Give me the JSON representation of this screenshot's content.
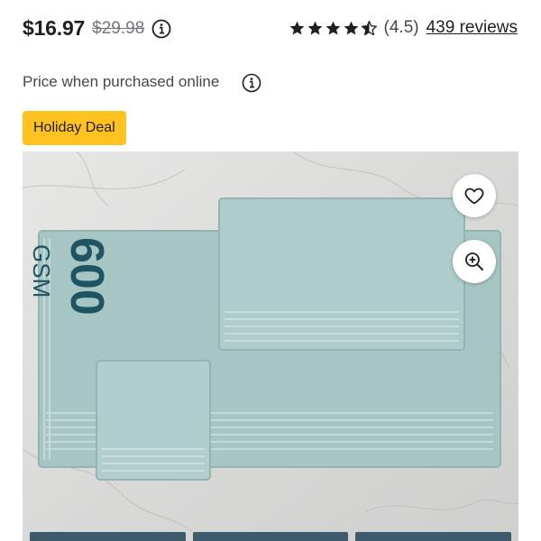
{
  "price": {
    "current": "$16.97",
    "was": "$29.98",
    "note": "Price when purchased online"
  },
  "rating": {
    "stars": 4.5,
    "value_text": "(4.5)",
    "reviews_text": "439 reviews"
  },
  "badge": {
    "label": "Holiday Deal"
  },
  "product_image": {
    "print_number": "600",
    "print_unit": "GSM"
  },
  "icons": {
    "info": "info-circle-icon",
    "favorite": "heart-icon",
    "zoom": "zoom-in-icon",
    "star": "star-icon"
  },
  "colors": {
    "badge": "#ffc220",
    "towel": "#a8c8c5",
    "print": "#1f5563",
    "variant_tab": "#3d5b6b"
  }
}
